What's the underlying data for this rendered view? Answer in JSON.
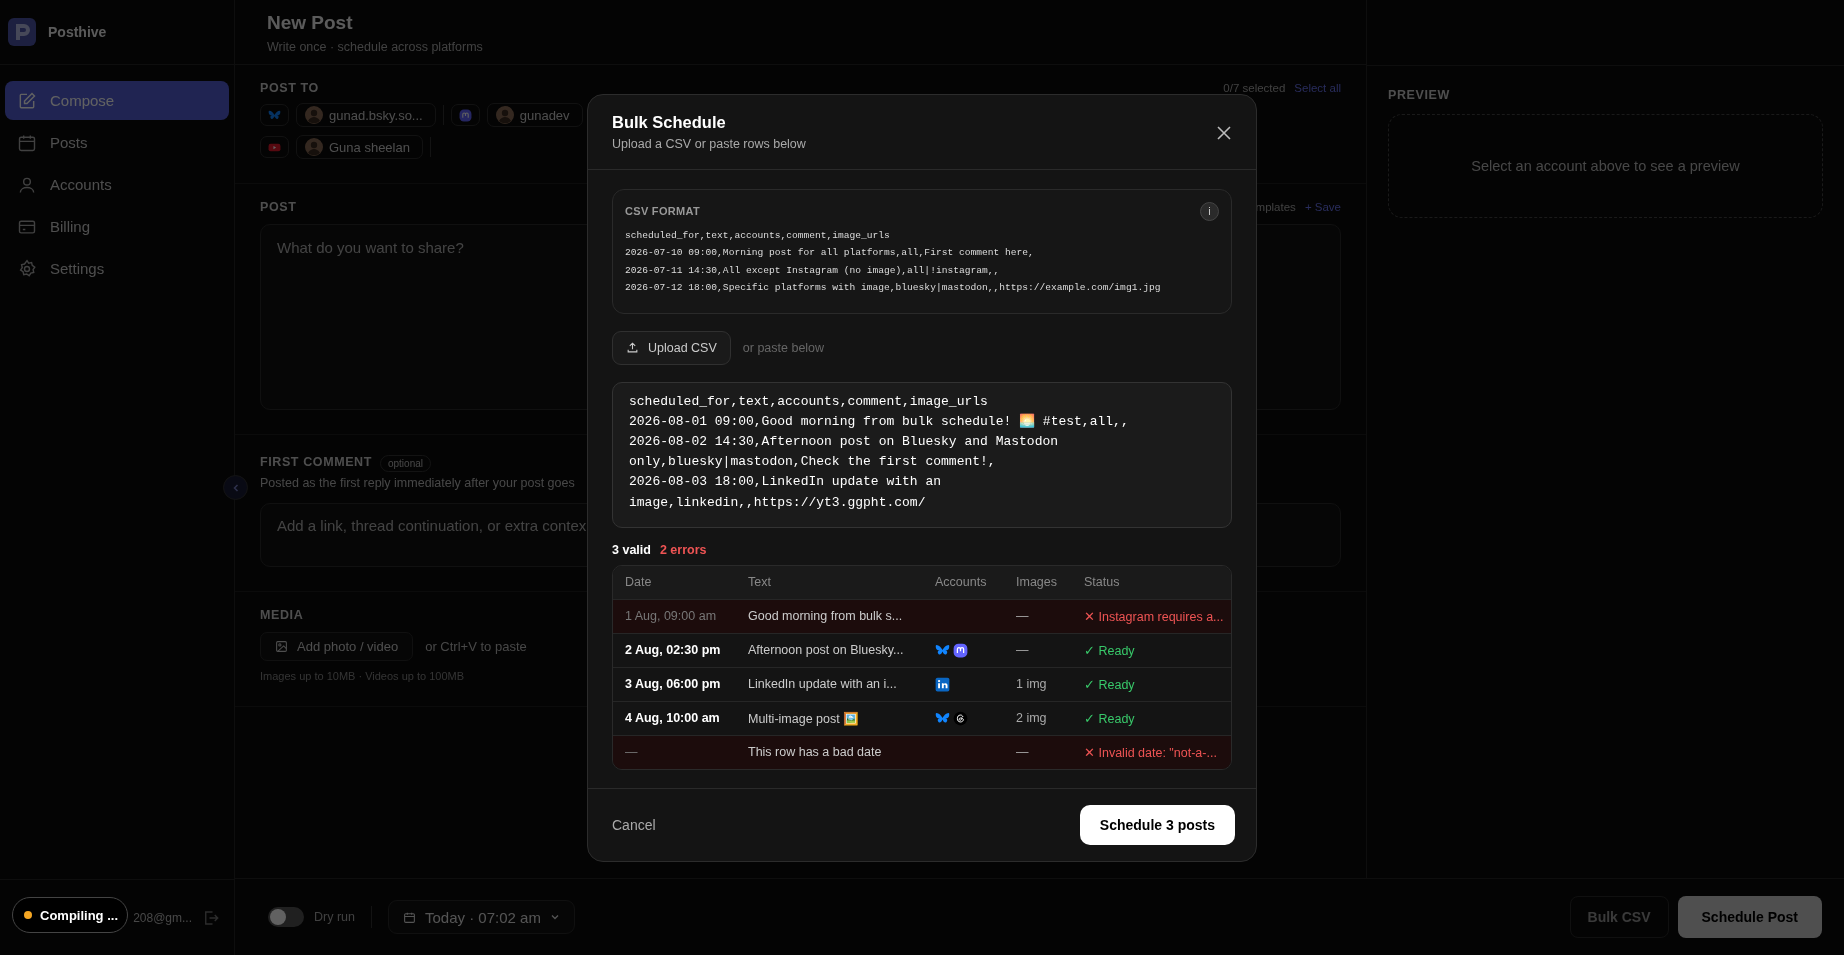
{
  "app": {
    "name": "Posthive"
  },
  "nav": [
    {
      "label": "Compose",
      "selected": true
    },
    {
      "label": "Posts",
      "selected": false
    },
    {
      "label": "Accounts",
      "selected": false
    },
    {
      "label": "Billing",
      "selected": false
    },
    {
      "label": "Settings",
      "selected": false
    }
  ],
  "user": {
    "email": "208@gm..."
  },
  "dev_indicator": {
    "label": "Compiling ..."
  },
  "page": {
    "title": "New Post",
    "subtitle": "Write once · schedule across platforms"
  },
  "post_to": {
    "label": "POST TO",
    "count": "0/7 selected",
    "select_all": "Select all",
    "rows": [
      [
        {
          "kind": "bluesky",
          "accounts": [
            "gunad.bsky.so..."
          ]
        },
        {
          "kind": "mastodon",
          "accounts": [
            "gunadev"
          ]
        }
      ],
      [
        {
          "kind": "youtube",
          "accounts": [
            "Guna sheelan"
          ]
        }
      ]
    ]
  },
  "post": {
    "label": "POST",
    "templates": "mplates",
    "save": "+ Save",
    "placeholder": "What do you want to share?"
  },
  "first_comment": {
    "label": "FIRST COMMENT",
    "badge": "optional",
    "description": "Posted as the first reply immediately after your post goes",
    "placeholder": "Add a link, thread continuation, or extra contex"
  },
  "media": {
    "label": "MEDIA",
    "button": "Add photo / video",
    "hint": "or Ctrl+V to paste",
    "limits": "Images up to 10MB · Videos up to 100MB"
  },
  "preview": {
    "label": "PREVIEW",
    "empty": "Select an account above to see a preview"
  },
  "bottom_bar": {
    "dry_run": {
      "label": "Dry run",
      "on": false
    },
    "date": "Today · 07:02 am",
    "bulk": "Bulk CSV",
    "schedule": "Schedule Post"
  },
  "modal": {
    "title": "Bulk Schedule",
    "subtitle": "Upload a CSV or paste rows below",
    "format": {
      "label": "CSV FORMAT",
      "info": "i",
      "lines": [
        "scheduled_for,text,accounts,comment,image_urls",
        "2026-07-10 09:00,Morning post for all platforms,all,First comment here,",
        "2026-07-11 14:30,All except Instagram (no image),all|!instagram,,",
        "2026-07-12 18:00,Specific platforms with image,bluesky|mastodon,,https://example.com/img1.jpg"
      ]
    },
    "upload": "Upload CSV",
    "paste_hint": "or paste below",
    "paste_value": "scheduled_for,text,accounts,comment,image_urls\n2026-08-01 09:00,Good morning from bulk schedule! 🌅 #test,all,,\n2026-08-02 14:30,Afternoon post on Bluesky and Mastodon only,bluesky|mastodon,Check the first comment!,\n2026-08-03 18:00,LinkedIn update with an image,linkedin,,https://yt3.ggpht.com/",
    "summary": {
      "valid": "3 valid",
      "errors": "2 errors"
    },
    "columns": [
      "Date",
      "Text",
      "Accounts",
      "Images",
      "Status"
    ],
    "rows": [
      {
        "valid": false,
        "date": "1 Aug, 09:00 am",
        "text": "Good morning from bulk s...",
        "images": "—",
        "status": "✕ Instagram requires a..."
      },
      {
        "valid": true,
        "date": "2 Aug, 02:30 pm",
        "text": "Afternoon post on Bluesky...",
        "accounts": [
          {
            "kind": "bluesky"
          },
          {
            "kind": "mastodon"
          }
        ],
        "images": "—",
        "status": "✓ Ready"
      },
      {
        "valid": true,
        "date": "3 Aug, 06:00 pm",
        "text": "LinkedIn update with an i...",
        "accounts": [
          {
            "kind": "linkedin"
          }
        ],
        "images": "1 img",
        "status": "✓ Ready"
      },
      {
        "valid": true,
        "date": "4 Aug, 10:00 am",
        "text": "Multi-image post 🖼️",
        "accounts": [
          {
            "kind": "bluesky"
          },
          {
            "kind": "threads"
          }
        ],
        "images": "2 img",
        "status": "✓ Ready"
      },
      {
        "valid": false,
        "date": "—",
        "text": "This row has a bad date",
        "images": "—",
        "status": "✕ Invalid date: \"not-a-..."
      }
    ],
    "cancel": "Cancel",
    "confirm": "Schedule 3 posts"
  }
}
